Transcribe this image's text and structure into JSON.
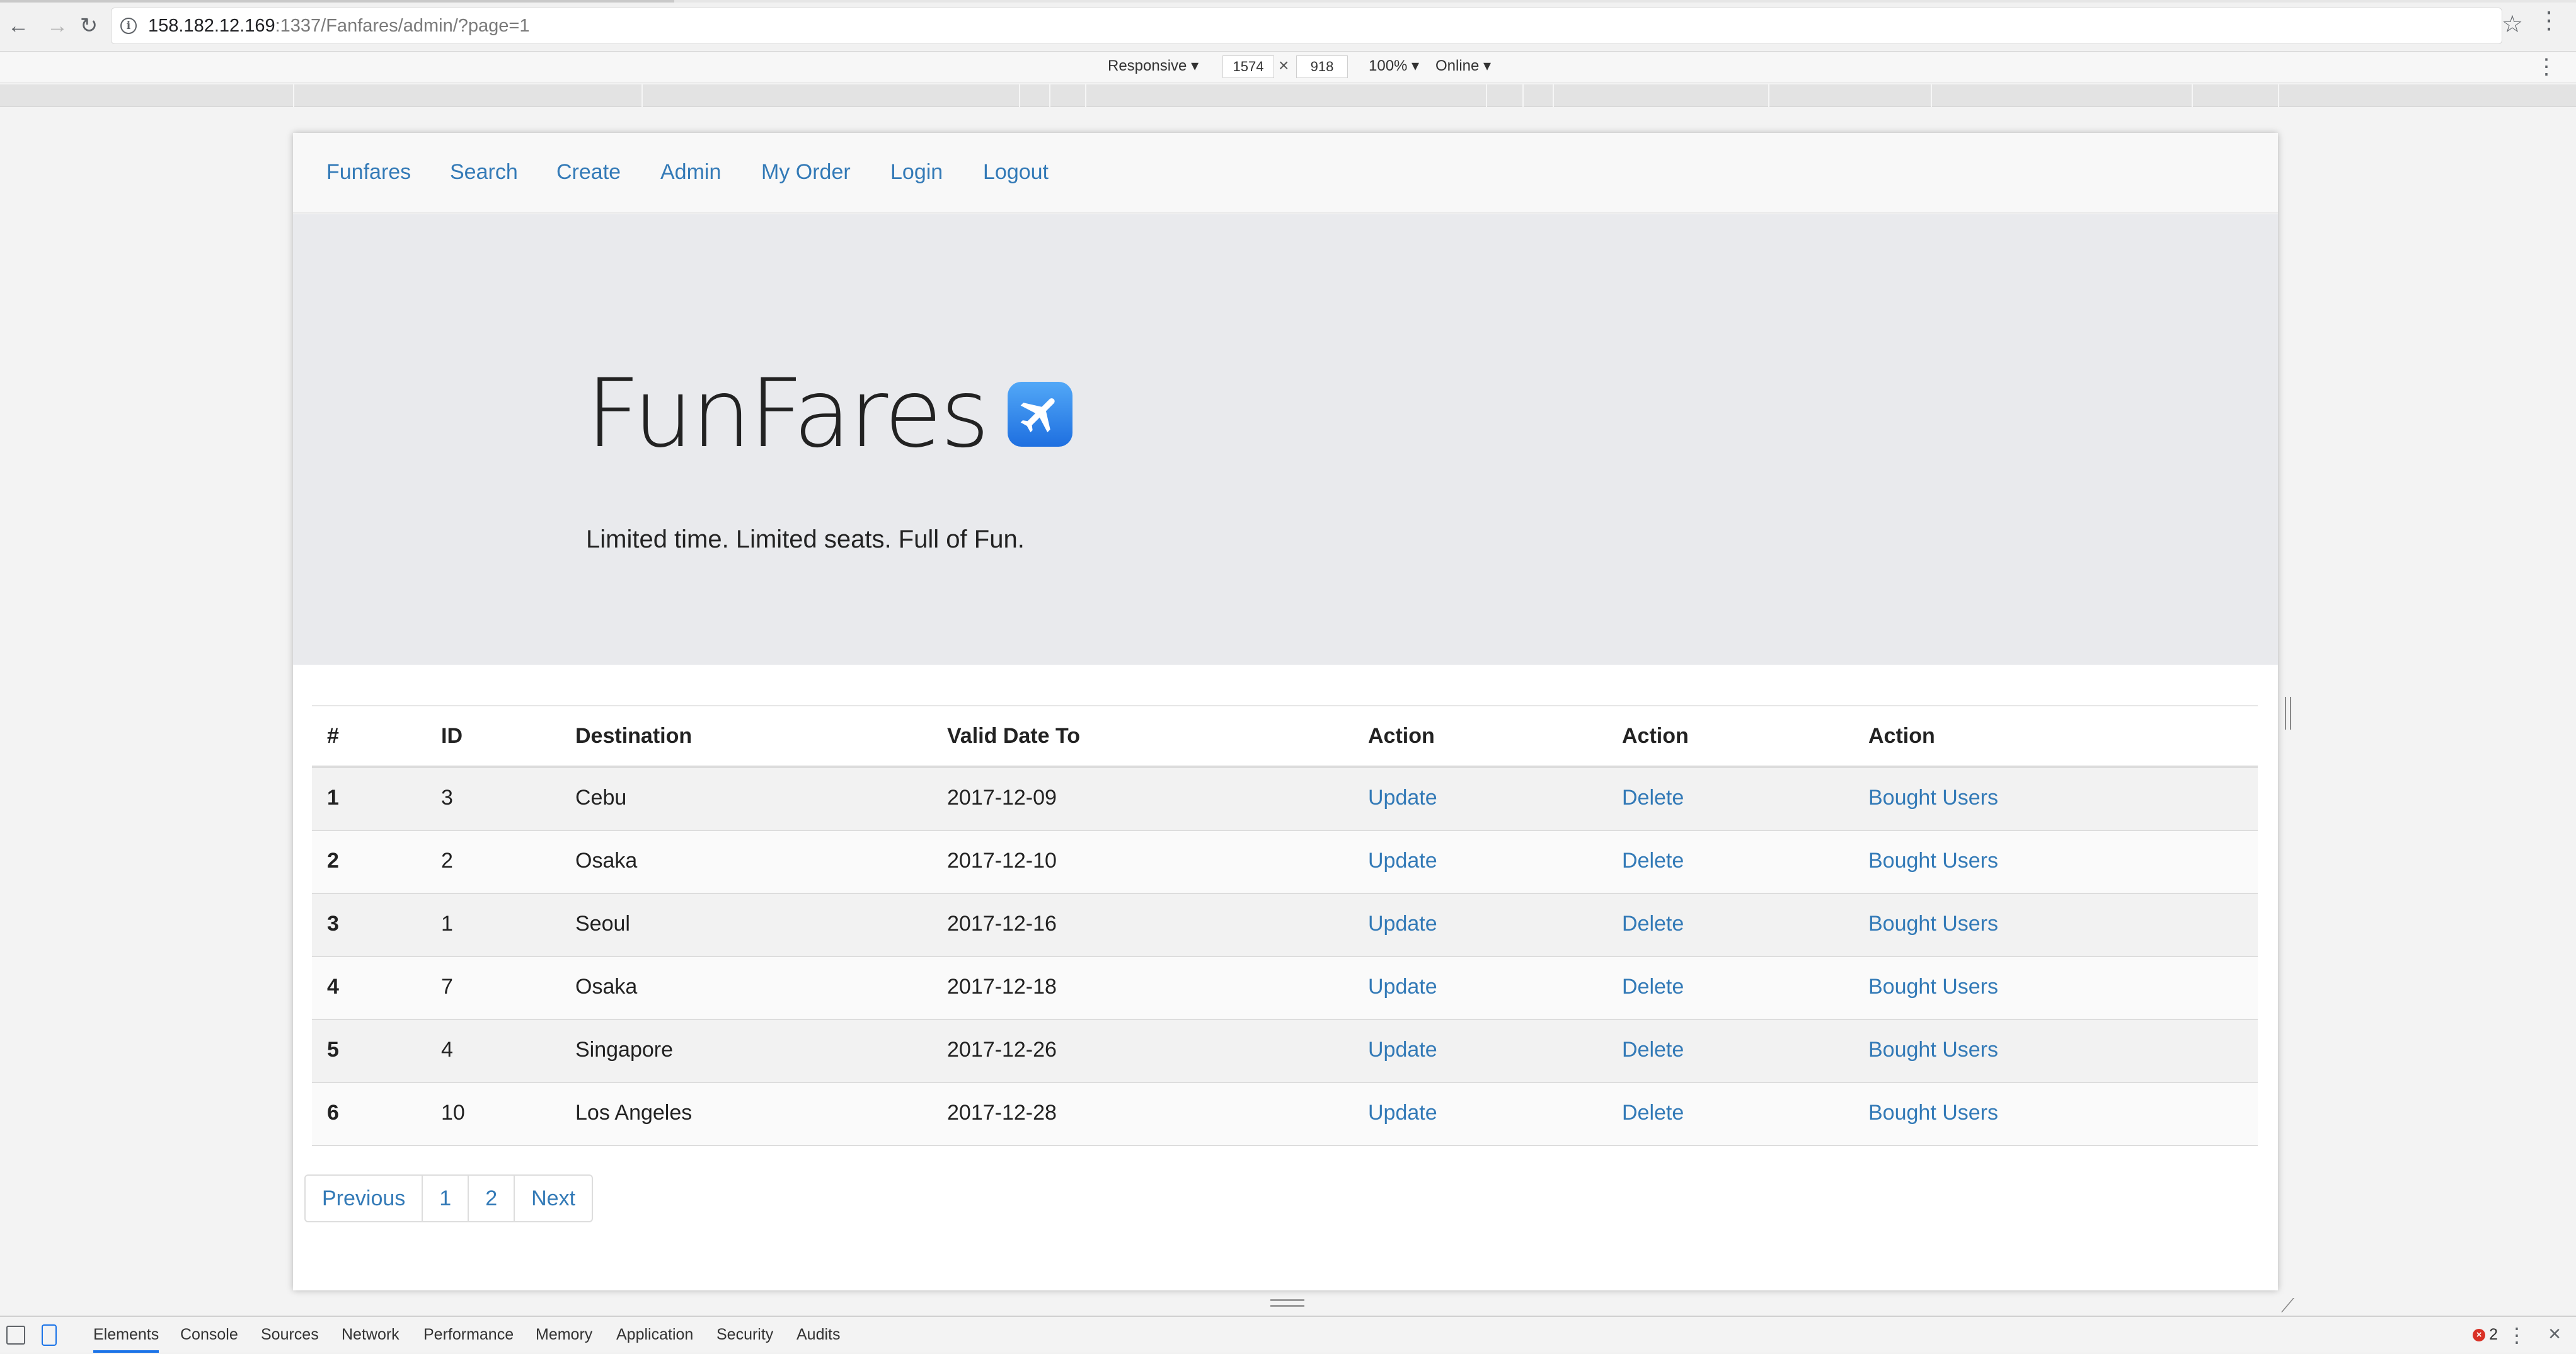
{
  "browser": {
    "url_host": "158.182.12.169",
    "url_rest": ":1337/Fanfares/admin/?page=1"
  },
  "device_toolbar": {
    "mode": "Responsive ▾",
    "width": "1574",
    "times": "×",
    "height": "918",
    "zoom": "100% ▾",
    "network": "Online ▾"
  },
  "nav": {
    "items": [
      "Funfares",
      "Search",
      "Create",
      "Admin",
      "My Order",
      "Login",
      "Logout"
    ]
  },
  "hero": {
    "title": "FunFares",
    "subtitle": "Limited time. Limited seats. Full of Fun."
  },
  "table": {
    "headers": [
      "#",
      "ID",
      "Destination",
      "Valid Date To",
      "Action",
      "Action",
      "Action"
    ],
    "rows": [
      {
        "num": "1",
        "id": "3",
        "destination": "Cebu",
        "date": "2017-12-09",
        "update": "Update",
        "delete": "Delete",
        "bought": "Bought Users"
      },
      {
        "num": "2",
        "id": "2",
        "destination": "Osaka",
        "date": "2017-12-10",
        "update": "Update",
        "delete": "Delete",
        "bought": "Bought Users"
      },
      {
        "num": "3",
        "id": "1",
        "destination": "Seoul",
        "date": "2017-12-16",
        "update": "Update",
        "delete": "Delete",
        "bought": "Bought Users"
      },
      {
        "num": "4",
        "id": "7",
        "destination": "Osaka",
        "date": "2017-12-18",
        "update": "Update",
        "delete": "Delete",
        "bought": "Bought Users"
      },
      {
        "num": "5",
        "id": "4",
        "destination": "Singapore",
        "date": "2017-12-26",
        "update": "Update",
        "delete": "Delete",
        "bought": "Bought Users"
      },
      {
        "num": "6",
        "id": "10",
        "destination": "Los Angeles",
        "date": "2017-12-28",
        "update": "Update",
        "delete": "Delete",
        "bought": "Bought Users"
      }
    ]
  },
  "pagination": {
    "items": [
      "Previous",
      "1",
      "2",
      "Next"
    ]
  },
  "devtools": {
    "tabs": [
      "Elements",
      "Console",
      "Sources",
      "Network",
      "Performance",
      "Memory",
      "Application",
      "Security",
      "Audits"
    ],
    "error_count": "2"
  },
  "colors": {
    "link": "#337ab7",
    "jumbotron": "#e9eaed",
    "navbar": "#f8f8f8"
  }
}
